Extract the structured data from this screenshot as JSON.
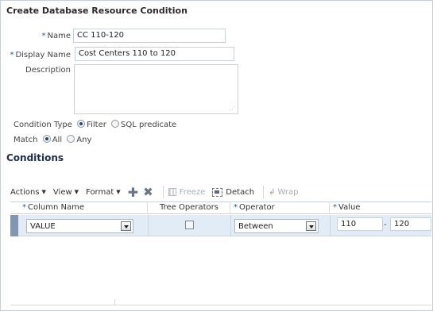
{
  "dialog": {
    "title": "Create Database Resource Condition"
  },
  "form": {
    "name_label": "Name",
    "name_value": "CC 110-120",
    "display_name_label": "Display Name",
    "display_name_value": "Cost Centers 110 to 120",
    "description_label": "Description",
    "description_value": "",
    "required_marker": "*",
    "condition_type_label": "Condition Type",
    "condition_type_options": [
      "Filter",
      "SQL predicate"
    ],
    "condition_type_selected": "Filter",
    "match_label": "Match",
    "match_options": [
      "All",
      "Any"
    ],
    "match_selected": "All"
  },
  "conditions": {
    "section_title": "Conditions",
    "toolbar": {
      "actions_label": "Actions",
      "view_label": "View",
      "format_label": "Format",
      "add_icon": "plus-icon",
      "delete_icon": "delete-icon",
      "freeze_label": "Freeze",
      "detach_label": "Detach",
      "wrap_label": "Wrap"
    },
    "columns": [
      "Column Name",
      "Tree Operators",
      "Operator",
      "Value"
    ],
    "required_columns": [
      "Column Name",
      "Operator",
      "Value"
    ],
    "rows": [
      {
        "column_name": "VALUE",
        "tree_operators_checked": false,
        "operator": "Between",
        "value_from": "110",
        "value_separator": "-",
        "value_to": "120"
      }
    ]
  },
  "colors": {
    "title_text": "#2b2b2b",
    "required_marker": "#1a5a9c",
    "selected_row_bg": "#e2ecf6",
    "row_marker": "#7f97b3"
  }
}
